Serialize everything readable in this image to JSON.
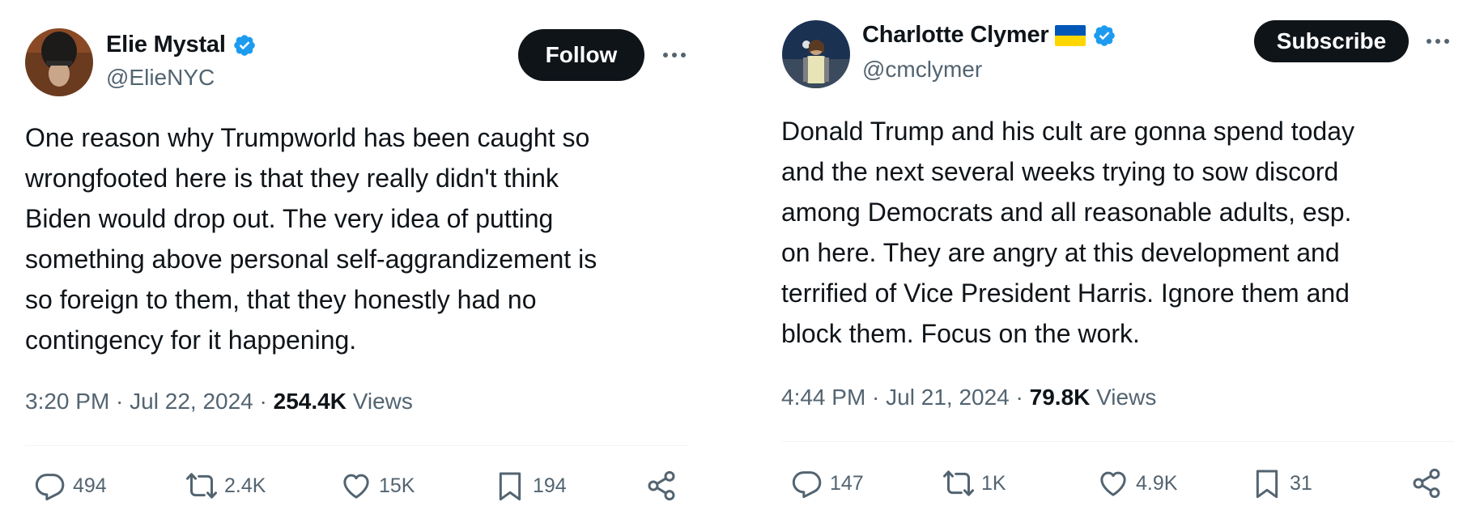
{
  "tweets": [
    {
      "author": {
        "name": "Elie Mystal",
        "handle": "@ElieNYC",
        "verified": true,
        "flag": null
      },
      "action_button": "Follow",
      "text": "One reason why Trumpworld has been caught so\nwrongfooted here is that they really didn't think\nBiden would drop out. The very idea of putting\nsomething above personal self-aggrandizement is\nso foreign to them, that they honestly had no\ncontingency for it happening.",
      "time": "3:20 PM",
      "date": "Jul 22, 2024",
      "views_count": "254.4K",
      "views_label": "Views",
      "stats": {
        "replies": "494",
        "reposts": "2.4K",
        "likes": "15K",
        "bookmarks": "194"
      }
    },
    {
      "author": {
        "name": "Charlotte Clymer",
        "handle": "@cmclymer",
        "verified": true,
        "flag": "ukraine-flag"
      },
      "action_button": "Subscribe",
      "text": "Donald Trump and his cult are gonna spend today\nand the next several weeks trying to sow discord\namong Democrats and all reasonable adults, esp.\non here. They are angry at this development and\nterrified of Vice President Harris. Ignore them and\nblock them. Focus on the work.",
      "time": "4:44 PM",
      "date": "Jul 21, 2024",
      "views_count": "79.8K",
      "views_label": "Views",
      "stats": {
        "replies": "147",
        "reposts": "1K",
        "likes": "4.9K",
        "bookmarks": "31"
      }
    }
  ],
  "icons": {
    "verified": "verified-badge-icon",
    "more": "more-options-icon",
    "reply": "reply-icon",
    "repost": "repost-icon",
    "like": "like-icon",
    "bookmark": "bookmark-icon",
    "share": "share-icon"
  },
  "colors": {
    "text": "#0f1419",
    "secondary": "#536471",
    "verified": "#1d9bf0",
    "button": "#0f1419",
    "divider": "#eff3f4"
  }
}
